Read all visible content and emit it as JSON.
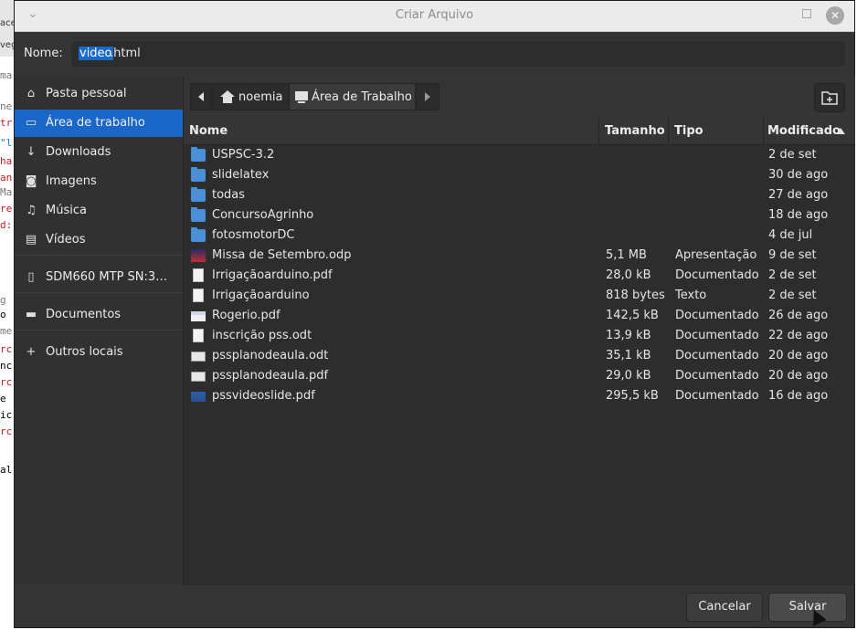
{
  "dialog": {
    "title": "Criar Arquivo",
    "close_glyph": "✕",
    "menu_glyph": "⌄"
  },
  "name_field": {
    "label": "Nome:",
    "selected_text": "video",
    "rest_text": ".html"
  },
  "sidebar": {
    "items": [
      {
        "label": "Pasta pessoal",
        "icon": "home-icon"
      },
      {
        "label": "Área de trabalho",
        "icon": "desktop-icon",
        "active": true
      },
      {
        "label": "Downloads",
        "icon": "download-icon"
      },
      {
        "label": "Imagens",
        "icon": "camera-icon"
      },
      {
        "label": "Música",
        "icon": "music-icon"
      },
      {
        "label": "Vídeos",
        "icon": "video-icon"
      },
      {
        "label": "SDM660 MTP  SN:3…",
        "icon": "phone-icon"
      },
      {
        "label": "Documentos",
        "icon": "folder-icon"
      },
      {
        "label": "Outros locais",
        "icon": "plus-icon"
      }
    ]
  },
  "pathbar": {
    "home_label": "noemia",
    "current_label": "Área de Trabalho"
  },
  "columns": {
    "name": "Nome",
    "size": "Tamanho",
    "type": "Tipo",
    "modified": "Modificado"
  },
  "files": [
    {
      "name": "USPSC-3.2",
      "size": "",
      "type": "",
      "date": "2 de set",
      "icon": "folder"
    },
    {
      "name": "slidelatex",
      "size": "",
      "type": "",
      "date": "30 de ago",
      "icon": "folder"
    },
    {
      "name": "todas",
      "size": "",
      "type": "",
      "date": "27 de ago",
      "icon": "folder"
    },
    {
      "name": "ConcursoAgrinho",
      "size": "",
      "type": "",
      "date": "18 de ago",
      "icon": "folder"
    },
    {
      "name": "fotosmotorDC",
      "size": "",
      "type": "",
      "date": "4 de jul",
      "icon": "folder"
    },
    {
      "name": "Missa de Setembro.odp",
      "size": "5,1 MB",
      "type": "Apresentação",
      "date": "9 de set",
      "icon": "odp"
    },
    {
      "name": "Irrigaçãoarduino.pdf",
      "size": "28,0 kB",
      "type": "Documentado",
      "date": "2 de set",
      "icon": "doc"
    },
    {
      "name": "Irrigaçãoarduino",
      "size": "818 bytes",
      "type": "Texto",
      "date": "2 de set",
      "icon": "doc"
    },
    {
      "name": "Rogerio.pdf",
      "size": "142,5 kB",
      "type": "Documentado",
      "date": "26 de ago",
      "icon": "thumb-wide"
    },
    {
      "name": "inscrição pss.odt",
      "size": "13,9 kB",
      "type": "Documentado",
      "date": "22 de ago",
      "icon": "doc"
    },
    {
      "name": "pssplanodeaula.odt",
      "size": "35,1 kB",
      "type": "Documentado",
      "date": "20 de ago",
      "icon": "thumb-grey"
    },
    {
      "name": "pssplanodeaula.pdf",
      "size": "29,0 kB",
      "type": "Documentado",
      "date": "20 de ago",
      "icon": "thumb-grey"
    },
    {
      "name": "pssvideoslide.pdf",
      "size": "295,5 kB",
      "type": "Documentado",
      "date": "16 de ago",
      "icon": "thumb-blue"
    }
  ],
  "buttons": {
    "cancel": "Cancelar",
    "save": "Salvar"
  },
  "background_editor": {
    "snippets": [
      "ace",
      "veg",
      "ma",
      "ne",
      "tr",
      "\"l",
      "ha",
      "an",
      "Ma",
      "re",
      "d:",
      "g",
      "o",
      "me",
      "rc",
      "nc",
      "rc",
      "e",
      "ic",
      "rc",
      "al"
    ],
    "colors": [
      "#000000",
      "#000000",
      "#777777",
      "#777777",
      "#c01c28",
      "#1c71d8",
      "#c01c28",
      "#c01c28",
      "#777777",
      "#c01c28",
      "#c01c28",
      "#777777",
      "#000000",
      "#777777",
      "#c01c28",
      "#000000",
      "#c01c28",
      "#000000",
      "#000000",
      "#c01c28",
      "#000000"
    ]
  }
}
